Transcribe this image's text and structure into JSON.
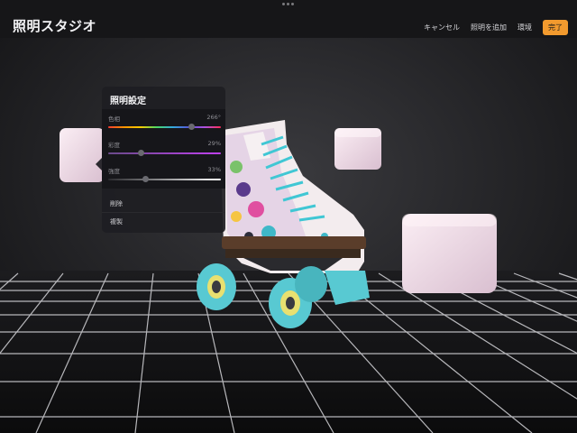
{
  "app": {
    "title": "照明スタジオ"
  },
  "top_actions": {
    "cancel_label": "キャンセル",
    "add_light_label": "照明を追加",
    "environment_label": "環境",
    "done_label": "完了"
  },
  "colors": {
    "accent": "#f29a2e",
    "panel": "#1e1e22"
  },
  "light_settings": {
    "title": "照明設定",
    "hue": {
      "label": "色相",
      "value_text": "266°",
      "value": 266
    },
    "saturation": {
      "label": "彩度",
      "value_text": "29%",
      "value": 29
    },
    "intensity": {
      "label": "強度",
      "value_text": "33%",
      "value": 33
    },
    "delete_label": "削除",
    "duplicate_label": "複製"
  }
}
